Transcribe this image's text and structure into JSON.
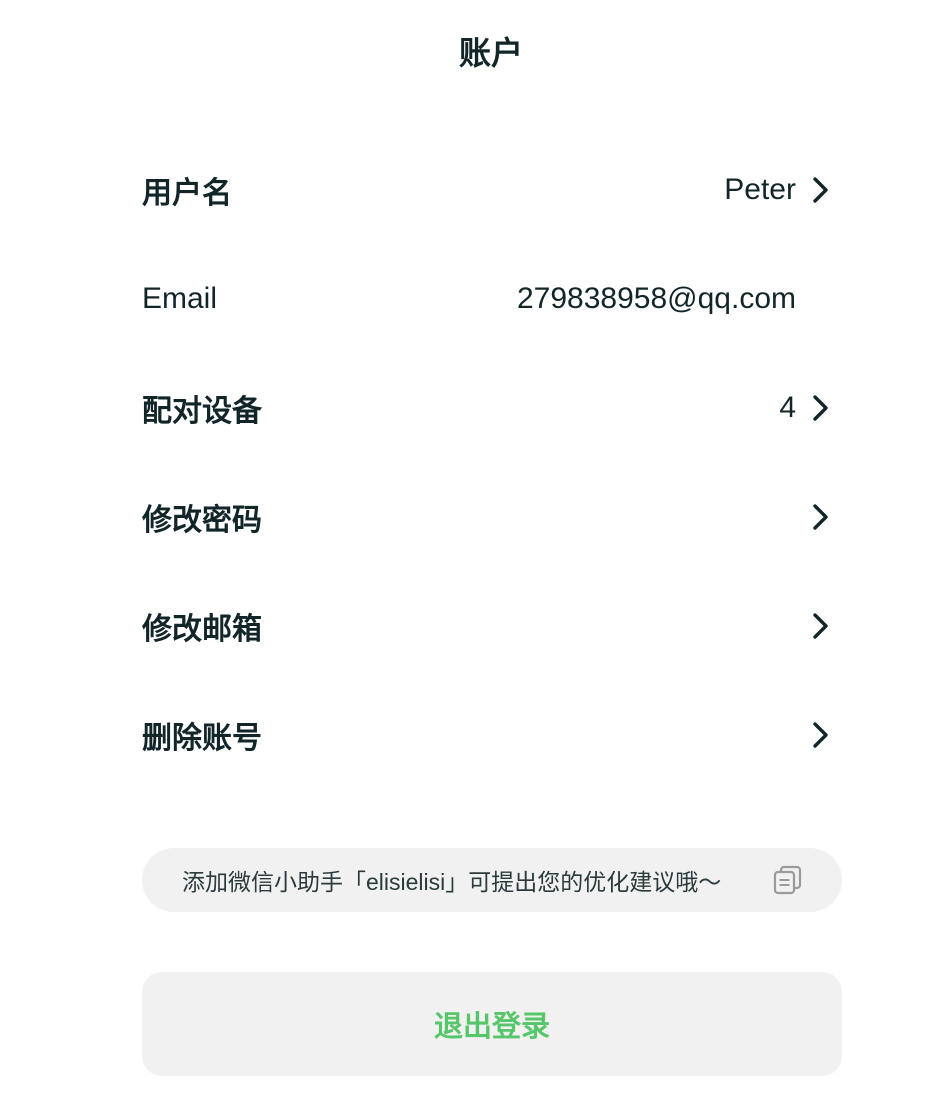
{
  "header": {
    "title": "账户"
  },
  "rows": [
    {
      "label": "用户名",
      "value": "Peter",
      "chevron": true
    },
    {
      "label": "Email",
      "value": "279838958@qq.com",
      "chevron": false
    },
    {
      "label": "配对设备",
      "value": "4",
      "chevron": true
    },
    {
      "label": "修改密码",
      "value": "",
      "chevron": true
    },
    {
      "label": "修改邮箱",
      "value": "",
      "chevron": true
    },
    {
      "label": "删除账号",
      "value": "",
      "chevron": true
    }
  ],
  "tip": {
    "text": "添加微信小助手「elisielisi」可提出您的优化建议哦～",
    "icon": "copy-icon"
  },
  "logout": {
    "label": "退出登录"
  },
  "colors": {
    "text": "#12262a",
    "accent_green": "#57c66a",
    "panel_bg": "#f1f1f1"
  }
}
